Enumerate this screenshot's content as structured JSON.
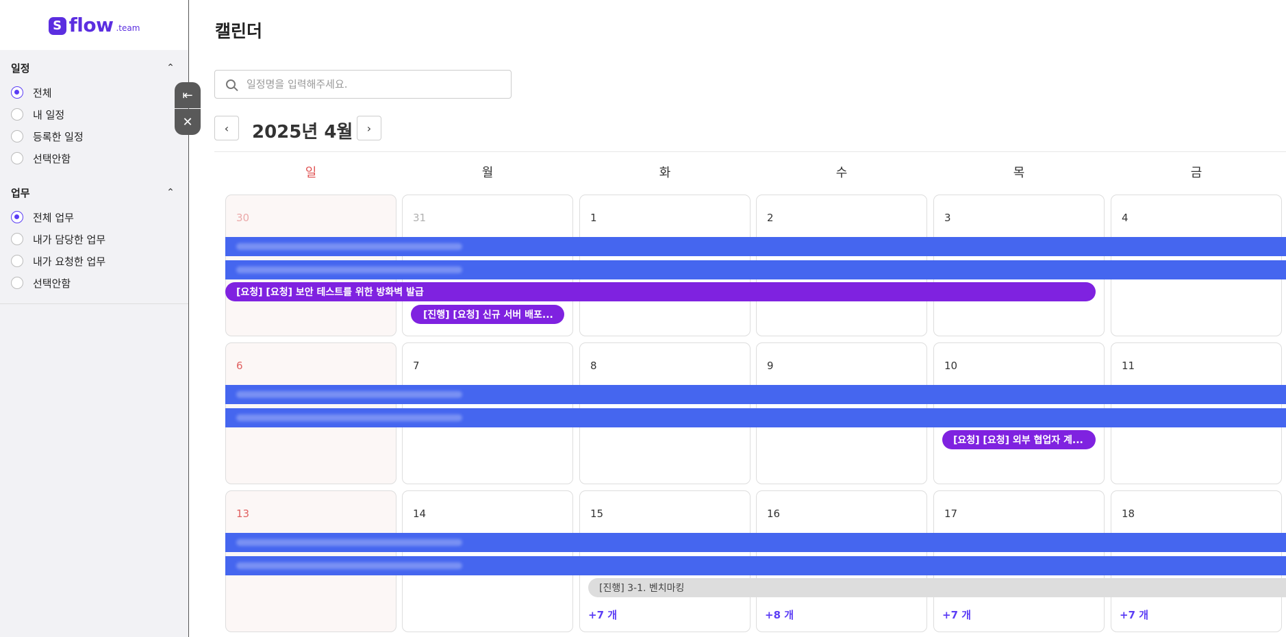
{
  "brand": {
    "mark": "S",
    "name": "flow",
    "suffix": ".team"
  },
  "sidebar": {
    "schedule": {
      "title": "일정",
      "options": [
        "전체",
        "내 일정",
        "등록한 일정",
        "선택안함"
      ],
      "selected": 0
    },
    "tasks": {
      "title": "업무",
      "options": [
        "전체 업무",
        "내가 담당한 업무",
        "내가 요청한 업무",
        "선택안함"
      ],
      "selected": 0
    }
  },
  "page": {
    "title": "캘린더",
    "search_placeholder": "일정명을 입력해주세요.",
    "month": "2025년 4월",
    "prev": "‹",
    "next": "›"
  },
  "weekdays": [
    "일",
    "월",
    "화",
    "수",
    "목",
    "금"
  ],
  "weeks": [
    {
      "days": [
        "30",
        "31",
        "1",
        "2",
        "3",
        "4"
      ],
      "muted": [
        true,
        true,
        false,
        false,
        false,
        false
      ]
    },
    {
      "days": [
        "6",
        "7",
        "8",
        "9",
        "10",
        "11"
      ],
      "muted": [
        false,
        false,
        false,
        false,
        false,
        false
      ]
    },
    {
      "days": [
        "13",
        "14",
        "15",
        "16",
        "17",
        "18"
      ],
      "muted": [
        false,
        false,
        false,
        false,
        false,
        false
      ]
    }
  ],
  "events": {
    "firewall": "[요청] [요청] 보안 테스트를 위한 방화벽 발급",
    "server_deploy": "[진행] [요청] 신규 서버 배포...",
    "external_partner": "[요청] [요청] 외부 협업자 계...",
    "benchmark": "[진행] 3-1. 벤치마킹"
  },
  "more_links": {
    "d15": "+7 개",
    "d16": "+8 개",
    "d17": "+7 개",
    "d18": "+7 개"
  },
  "colors": {
    "accent": "#5b3df5",
    "blue_event": "#4566ef",
    "purple_event": "#7f22e0",
    "sunday": "#e05555"
  }
}
